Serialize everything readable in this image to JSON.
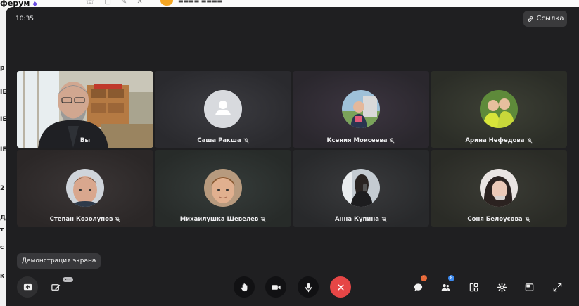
{
  "background_app": {
    "title": "ферум",
    "left_letters": [
      "р",
      "IE",
      "IE",
      "IE",
      "2",
      "Д",
      "т",
      "с",
      "к"
    ]
  },
  "call": {
    "clock": "10:35",
    "link_button": "Ссылка",
    "tooltip": "Демонстрация экрана",
    "participants": [
      {
        "name": "Вы",
        "muted": false,
        "video": true
      },
      {
        "name": "Саша Ракша",
        "muted": true,
        "avatar": "default-user-icon"
      },
      {
        "name": "Ксения Моисеева",
        "muted": true,
        "avatar": "photo"
      },
      {
        "name": "Арина Нефедова",
        "muted": true,
        "avatar": "photo"
      },
      {
        "name": "Степан Козолупов",
        "muted": true,
        "avatar": "photo"
      },
      {
        "name": "Михаилушка Шевелев",
        "muted": true,
        "avatar": "photo"
      },
      {
        "name": "Анна Купина",
        "muted": true,
        "avatar": "photo"
      },
      {
        "name": "Соня Белоусова",
        "muted": true,
        "avatar": "photo"
      }
    ],
    "controls": {
      "chat_badge": "1",
      "participants_badge": "8"
    },
    "colors": {
      "end_call": "#e64646",
      "window_bg": "#1f1f21",
      "badge_orange": "#e86a3a",
      "badge_blue": "#3d8bf0"
    }
  }
}
